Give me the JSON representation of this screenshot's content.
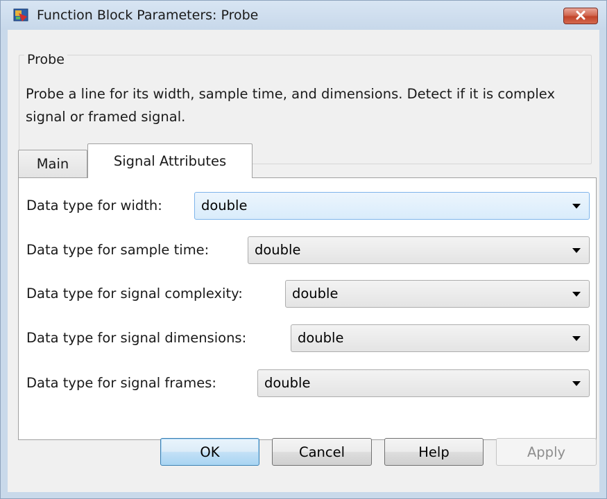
{
  "window": {
    "title": "Function Block Parameters: Probe",
    "icon": "simulink-block-icon",
    "close_icon": "close-icon"
  },
  "block": {
    "name": "Probe",
    "description": "Probe a line for its width, sample time, and dimensions. Detect if it is complex signal or framed signal."
  },
  "tabs": [
    {
      "label": "Main",
      "selected": false
    },
    {
      "label": "Signal Attributes",
      "selected": true
    }
  ],
  "parameters": [
    {
      "label": "Data type for width:",
      "value": "double",
      "focused": true
    },
    {
      "label": "Data type for sample time:",
      "value": "double",
      "focused": false
    },
    {
      "label": "Data type for signal complexity:",
      "value": "double",
      "focused": false
    },
    {
      "label": "Data type for signal dimensions:",
      "value": "double",
      "focused": false
    },
    {
      "label": "Data type for signal frames:",
      "value": "double",
      "focused": false
    }
  ],
  "buttons": {
    "ok": "OK",
    "cancel": "Cancel",
    "help": "Help",
    "apply": "Apply",
    "apply_enabled": false
  },
  "colors": {
    "close_button": "#c94a30",
    "focus_border": "#7eb4ea",
    "default_button_border": "#3c7fb1"
  }
}
